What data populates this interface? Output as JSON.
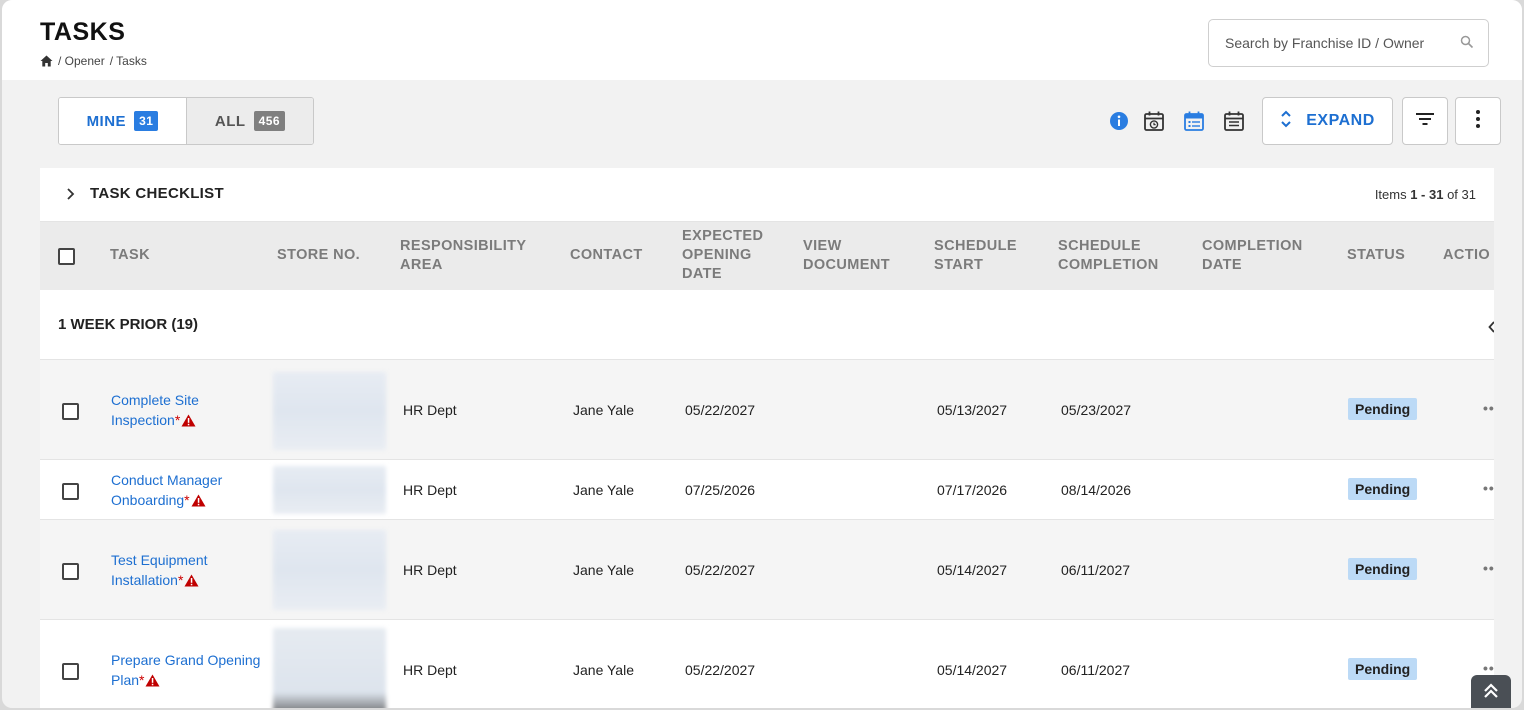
{
  "header": {
    "title": "TASKS",
    "breadcrumb": [
      "/ Opener",
      "/ Tasks"
    ]
  },
  "search": {
    "placeholder": "Search by Franchise ID / Owner"
  },
  "toggle": {
    "mine_label": "MINE",
    "mine_count": "31",
    "all_label": "ALL",
    "all_count": "456"
  },
  "toolbar": {
    "icons": [
      "info-icon",
      "calendar-clock-icon",
      "calendar-list-icon",
      "calendar-notes-icon"
    ],
    "expand_label": "EXPAND"
  },
  "panel": {
    "title": "TASK CHECKLIST",
    "items_prefix": "Items ",
    "items_range": "1 - 31",
    "items_suffix": " of 31"
  },
  "columns": [
    "TASK",
    "STORE NO.",
    "RESPONSIBILITY\nAREA",
    "CONTACT",
    "EXPECTED\nOPENING\nDATE",
    "VIEW\nDOCUMENT",
    "SCHEDULE\nSTART",
    "SCHEDULE\nCOMPLETION",
    "COMPLETION\nDATE",
    "STATUS",
    "ACTIO"
  ],
  "group": {
    "label": "1 WEEK PRIOR (19)"
  },
  "rows": [
    {
      "task_line1": "Complete Site",
      "task_line2": "Inspection",
      "req": "*",
      "area": "HR Dept",
      "contact": "Jane Yale",
      "expected": "05/22/2027",
      "start": "05/13/2027",
      "completion": "05/23/2027",
      "status": "Pending",
      "actions": "••"
    },
    {
      "task_line1": "Conduct Manager",
      "task_line2": "Onboarding",
      "req": "*",
      "area": "HR Dept",
      "contact": "Jane Yale",
      "expected": "07/25/2026",
      "start": "07/17/2026",
      "completion": "08/14/2026",
      "status": "Pending",
      "actions": "••"
    },
    {
      "task_line1": "Test Equipment",
      "task_line2": "Installation",
      "req": "*",
      "area": "HR Dept",
      "contact": "Jane Yale",
      "expected": "05/22/2027",
      "start": "05/14/2027",
      "completion": "06/11/2027",
      "status": "Pending",
      "actions": "••"
    },
    {
      "task_line1": "Prepare Grand Opening",
      "task_line2": "Plan",
      "req": "*",
      "area": "HR Dept",
      "contact": "Jane Yale",
      "expected": "05/22/2027",
      "start": "05/14/2027",
      "completion": "06/11/2027",
      "status": "Pending",
      "actions": "••"
    }
  ],
  "colors": {
    "accent": "#1d6fd1",
    "status_pending_bg": "#bcdaf6",
    "warning": "#c00000"
  }
}
